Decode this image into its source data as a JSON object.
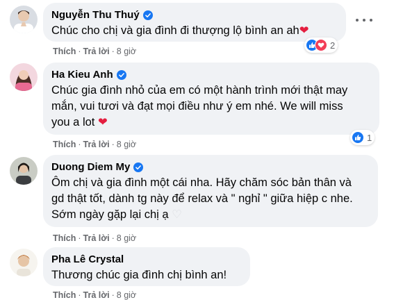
{
  "comments": [
    {
      "name": "Nguyễn Thu Thuý",
      "text": "Chúc cho chị và gia đình đi thượng lộ bình an ah",
      "emoji": "❤",
      "like_label": "Thích",
      "reply_label": "Trả lời",
      "time": "8 giờ",
      "reaction_count": "2",
      "reactions": [
        "like-icon",
        "love-icon"
      ]
    },
    {
      "name": "Ha Kieu Anh",
      "text": "Chúc gia đình nhỏ của em có một hành trình mới thật may mắn, vui tươi và đạt mọi điều như ý em nhé. We will miss you a lot",
      "emoji": "❤",
      "like_label": "Thích",
      "reply_label": "Trả lời",
      "time": "8 giờ",
      "reaction_count": "1",
      "reactions": [
        "like-icon"
      ]
    },
    {
      "name": "Duong Diem My",
      "text": "Ôm chị và gia đình một cái nha. Hãy chăm sóc bản thân và gd thật tốt, dành tg này để relax và \" nghỉ \" giữa hiệp c nhe. Sớm ngày gặp lại chị ạ",
      "emoji": "♡",
      "like_label": "Thích",
      "reply_label": "Trả lời",
      "time": "8 giờ"
    },
    {
      "name": "Pha Lê Crystal",
      "text": "Thương chúc gia đình chị bình an!",
      "like_label": "Thích",
      "reply_label": "Trả lời",
      "time": "8 giờ"
    }
  ],
  "colors": {
    "bubble": "#f0f2f5",
    "verified": "#1877f2",
    "meta": "#65676b",
    "heart": "#e41e3f"
  }
}
